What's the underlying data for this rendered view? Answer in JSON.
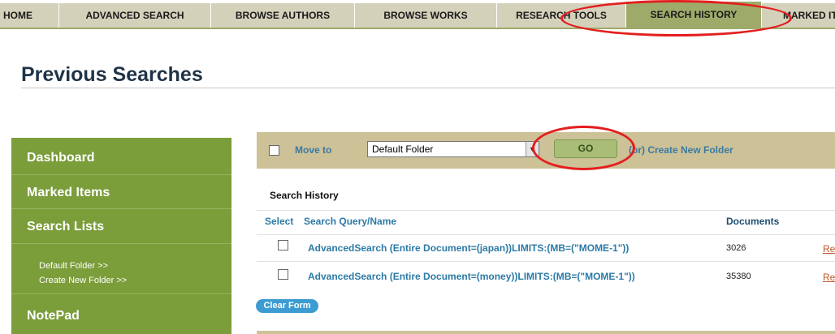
{
  "nav": {
    "tabs": [
      {
        "label": "HOME"
      },
      {
        "label": "ADVANCED SEARCH"
      },
      {
        "label": "BROWSE AUTHORS"
      },
      {
        "label": "BROWSE WORKS"
      },
      {
        "label": "RESEARCH TOOLS"
      },
      {
        "label": "SEARCH HISTORY"
      },
      {
        "label": "MARKED ITEMS"
      }
    ],
    "active": "SEARCH HISTORY"
  },
  "page_title": "Previous Searches",
  "sidebar": {
    "dashboard": "Dashboard",
    "marked_items": "Marked Items",
    "search_lists": "Search Lists",
    "default_folder": "Default Folder >>",
    "create_new_folder": "Create New Folder >>",
    "notepad": "NotePad"
  },
  "actions": {
    "move_to": "Move to",
    "folder_value": "Default Folder",
    "go": "GO",
    "or_create": "(or) Create New Folder"
  },
  "history": {
    "title": "Search History",
    "col_select": "Select",
    "col_query": "Search Query/Name",
    "col_documents": "Documents",
    "rows": [
      {
        "query": "AdvancedSearch (Entire Document=(japan))LIMITS:(MB=(\"MOME-1\"))",
        "documents": "3026",
        "action": "Re"
      },
      {
        "query": "AdvancedSearch (Entire Document=(money))LIMITS:(MB=(\"MOME-1\"))",
        "documents": "35380",
        "action": "Re"
      }
    ],
    "clear_form": "Clear Form"
  },
  "colors": {
    "sidebar": "#7b9d3a",
    "action_bar": "#ccc197",
    "link": "#3a7aa3",
    "annotation": "#e41e1e"
  }
}
